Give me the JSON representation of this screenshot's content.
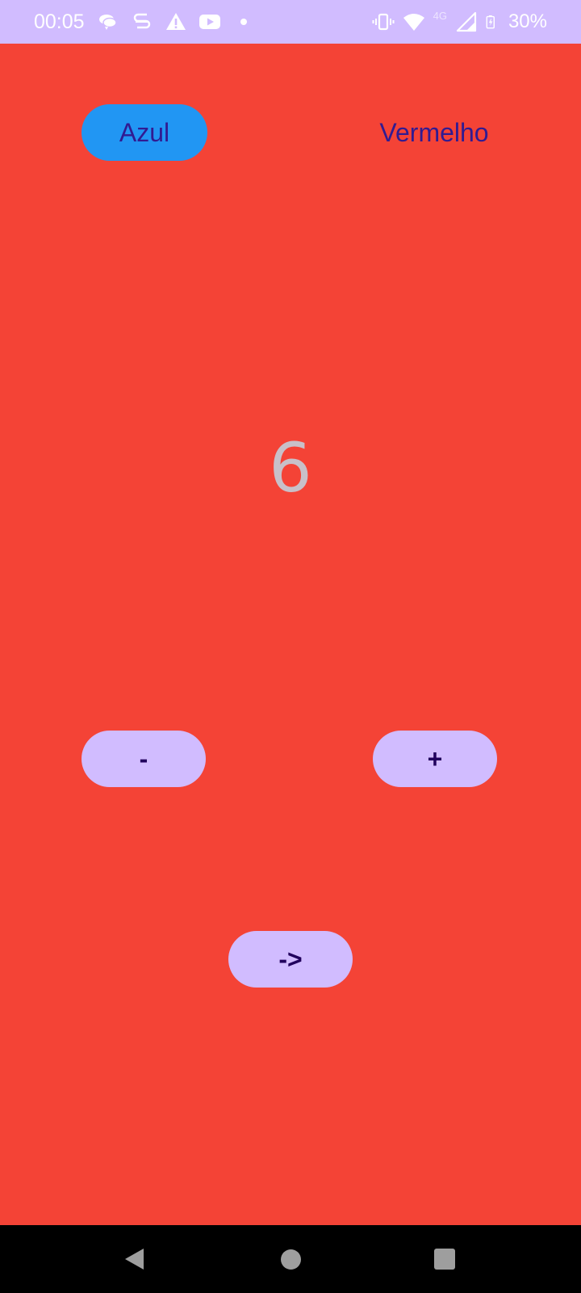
{
  "status_bar": {
    "time": "00:05",
    "network_label": "4G",
    "battery_percent": "30%",
    "left_icons": [
      "chat-bubbles-icon",
      "s-app-icon",
      "warning-icon",
      "youtube-icon",
      "dot-icon"
    ],
    "right_icons": [
      "vibrate-icon",
      "wifi-icon",
      "signal-icon",
      "battery-charging-icon"
    ],
    "background_color": "#D1BCFF"
  },
  "app": {
    "background_color": "#F44336",
    "color_toggle": {
      "blue_label": "Azul",
      "red_label": "Vermelho",
      "selected": "Azul",
      "blue_color": "#2196F3"
    },
    "counter_value": "6",
    "decrement_label": "-",
    "increment_label": "+",
    "next_label": "->"
  },
  "nav_bar": {
    "buttons": [
      "back-icon",
      "home-icon",
      "recents-icon"
    ]
  }
}
